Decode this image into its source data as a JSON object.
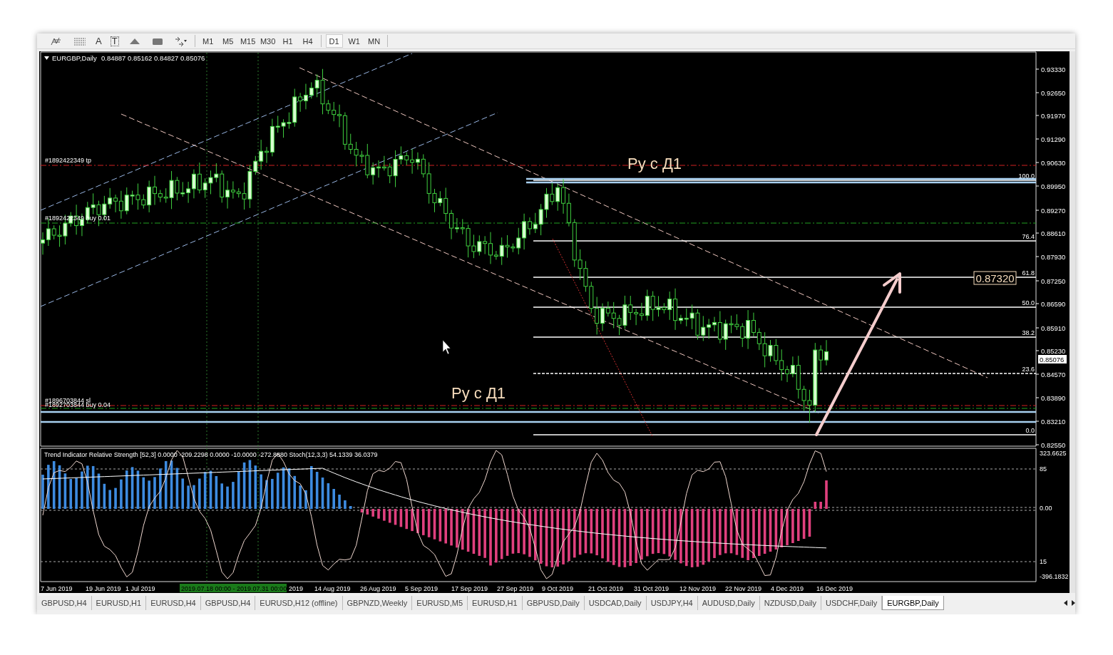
{
  "toolbar": {
    "tools": [
      {
        "kind": "elliott"
      },
      {
        "kind": "fibo"
      },
      {
        "kind": "text",
        "label": "A"
      },
      {
        "kind": "label",
        "label": "T"
      },
      {
        "kind": "triangle"
      },
      {
        "kind": "rectangle"
      },
      {
        "kind": "arrows"
      }
    ],
    "timeframes": [
      {
        "label": "M1",
        "selected": false
      },
      {
        "label": "M5",
        "selected": false
      },
      {
        "label": "M15",
        "selected": false
      },
      {
        "label": "M30",
        "selected": false
      },
      {
        "label": "H1",
        "selected": false
      },
      {
        "label": "H4",
        "selected": false
      },
      {
        "label": "D1",
        "selected": true
      },
      {
        "label": "W1",
        "selected": false
      },
      {
        "label": "MN",
        "selected": false
      }
    ]
  },
  "chart": {
    "symbol": "EURGBP,Daily",
    "ohlc": "0.84887 0.85162 0.84827 0.85076",
    "order_labels": [
      "#1892422349 tp",
      "#1892422349 buy 0.01",
      "#1896703844 sl",
      "#1892703844 buy 0.04"
    ],
    "annotations": [
      "Ру с Д1",
      "Ру с Д1"
    ],
    "fib_levels": [
      "100.0",
      "76.4",
      "61.8",
      "50.0",
      "38.2",
      "23.6",
      "0.0"
    ],
    "price_label": "0.87320",
    "current_price": "0.85076",
    "price_axis": [
      "0.93330",
      "0.92650",
      "0.91970",
      "0.91290",
      "0.90630",
      "0.89950",
      "0.89270",
      "0.88610",
      "0.87930",
      "0.87250",
      "0.86590",
      "0.85910",
      "0.85230",
      "0.84570",
      "0.83890",
      "0.83210",
      "0.82550"
    ],
    "indicator": {
      "title": "Trend Indicator Relative Strength [52,3]  0.0000 -209.2298 0.0000 -10.0000 -272.8880  Stoch(12,3,3) 54.1339 36.0379",
      "axis": [
        "323.6625",
        "85",
        "0.00",
        "15",
        "-396.1832"
      ]
    },
    "period_label": "2019.07.18 00:00 - 2019.07.31 00:00",
    "date_axis": [
      "7 Jun 2019",
      "19 Jun 2019",
      "1 Jul 2019",
      "2019",
      "14 Aug 2019",
      "26 Aug 2019",
      "5 Sep 2019",
      "17 Sep 2019",
      "27 Sep 2019",
      "9 Oct 2019",
      "21 Oct 2019",
      "31 Oct 2019",
      "12 Nov 2019",
      "22 Nov 2019",
      "4 Dec 2019",
      "16 Dec 2019"
    ]
  },
  "tabs": [
    {
      "label": "GBPUSD,H4",
      "selected": false
    },
    {
      "label": "EURUSD,H1",
      "selected": false
    },
    {
      "label": "EURUSD,H4",
      "selected": false
    },
    {
      "label": "GBPUSD,H4",
      "selected": false
    },
    {
      "label": "EURUSD,H12 (offline)",
      "selected": false
    },
    {
      "label": "GBPNZD,Weekly",
      "selected": false
    },
    {
      "label": "EURUSD,M5",
      "selected": false
    },
    {
      "label": "EURUSD,H1",
      "selected": false
    },
    {
      "label": "GBPUSD,Daily",
      "selected": false
    },
    {
      "label": "USDCAD,Daily",
      "selected": false
    },
    {
      "label": "USDJPY,H4",
      "selected": false
    },
    {
      "label": "AUDUSD,Daily",
      "selected": false
    },
    {
      "label": "NZDUSD,Daily",
      "selected": false
    },
    {
      "label": "USDCHF,Daily",
      "selected": false
    },
    {
      "label": "EURGBP,Daily",
      "selected": true
    }
  ]
}
